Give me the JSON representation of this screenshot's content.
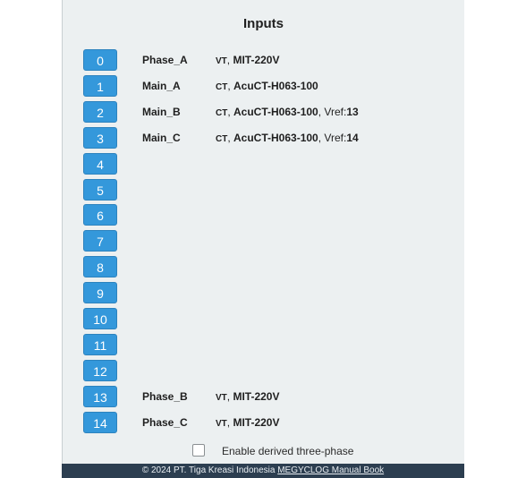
{
  "title": "Inputs",
  "inputs": [
    {
      "number": "0",
      "name": "Phase_A",
      "kind": "VT",
      "model": "MIT-220V",
      "vref_label": "",
      "vref": ""
    },
    {
      "number": "1",
      "name": "Main_A",
      "kind": "CT",
      "model": "AcuCT-H063-100",
      "vref_label": "",
      "vref": ""
    },
    {
      "number": "2",
      "name": "Main_B",
      "kind": "CT",
      "model": "AcuCT-H063-100",
      "vref_label": ", Vref:",
      "vref": "13"
    },
    {
      "number": "3",
      "name": "Main_C",
      "kind": "CT",
      "model": "AcuCT-H063-100",
      "vref_label": ", Vref:",
      "vref": "14"
    },
    {
      "number": "4",
      "name": "",
      "kind": "",
      "model": "",
      "vref_label": "",
      "vref": ""
    },
    {
      "number": "5",
      "name": "",
      "kind": "",
      "model": "",
      "vref_label": "",
      "vref": ""
    },
    {
      "number": "6",
      "name": "",
      "kind": "",
      "model": "",
      "vref_label": "",
      "vref": ""
    },
    {
      "number": "7",
      "name": "",
      "kind": "",
      "model": "",
      "vref_label": "",
      "vref": ""
    },
    {
      "number": "8",
      "name": "",
      "kind": "",
      "model": "",
      "vref_label": "",
      "vref": ""
    },
    {
      "number": "9",
      "name": "",
      "kind": "",
      "model": "",
      "vref_label": "",
      "vref": ""
    },
    {
      "number": "10",
      "name": "",
      "kind": "",
      "model": "",
      "vref_label": "",
      "vref": ""
    },
    {
      "number": "11",
      "name": "",
      "kind": "",
      "model": "",
      "vref_label": "",
      "vref": ""
    },
    {
      "number": "12",
      "name": "",
      "kind": "",
      "model": "",
      "vref_label": "",
      "vref": ""
    },
    {
      "number": "13",
      "name": "Phase_B",
      "kind": "VT",
      "model": "MIT-220V",
      "vref_label": "",
      "vref": ""
    },
    {
      "number": "14",
      "name": "Phase_C",
      "kind": "VT",
      "model": "MIT-220V",
      "vref_label": "",
      "vref": ""
    }
  ],
  "derived_three_phase": {
    "label": "Enable derived three-phase",
    "checked": false
  },
  "footer": {
    "copyright": "© 2024 PT. Tiga Kreasi Indonesia ",
    "link": "MEGYCLOG Manual Book"
  },
  "colors": {
    "button": "#3498db",
    "panel": "#ecf0f1",
    "footer": "#2c3e50"
  }
}
